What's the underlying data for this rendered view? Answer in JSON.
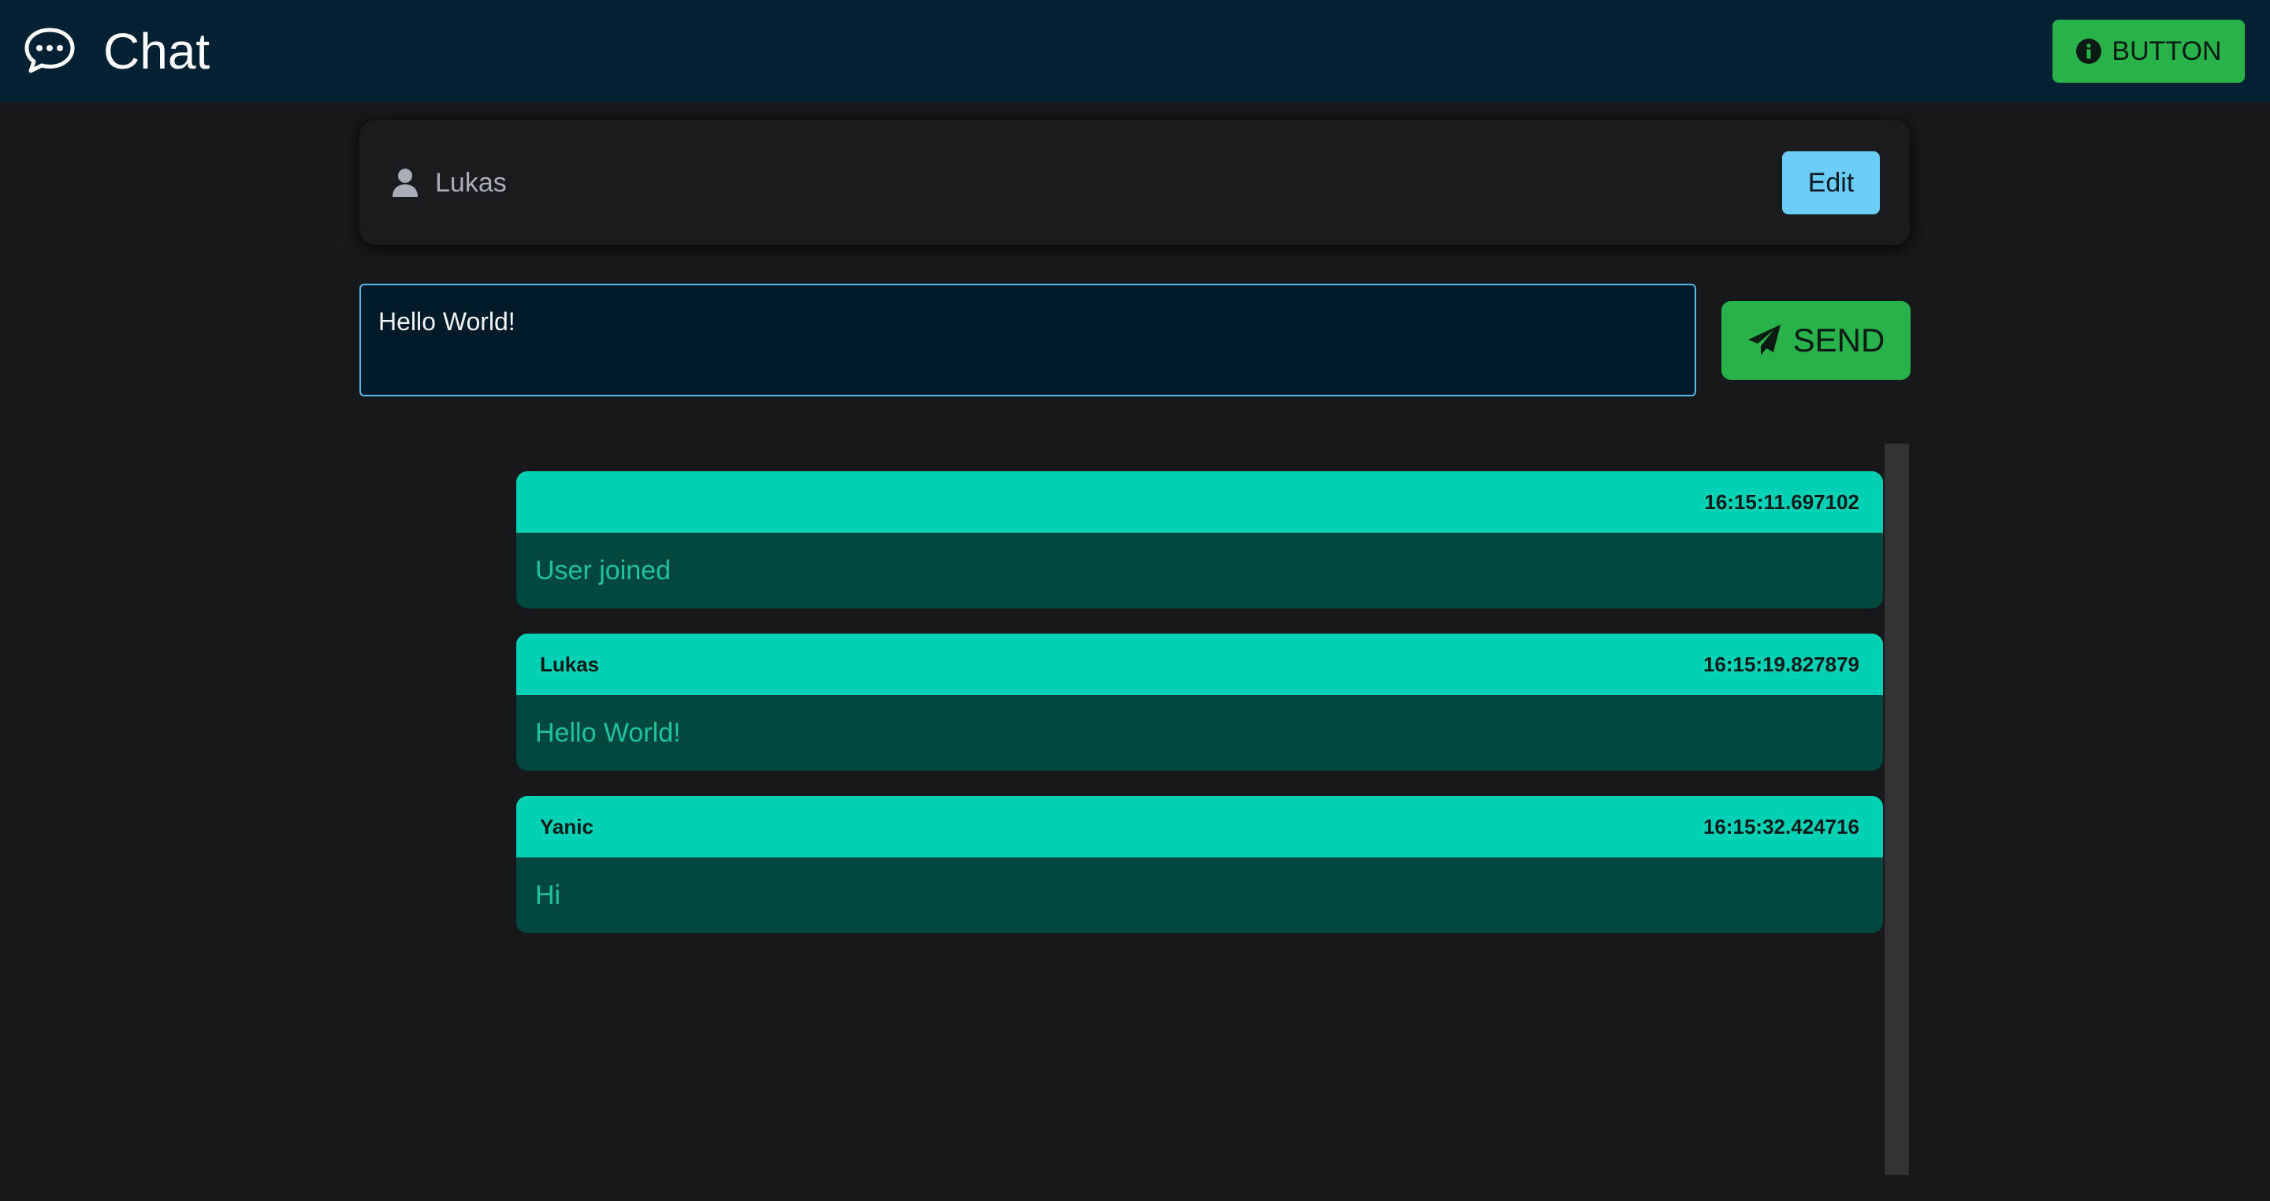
{
  "header": {
    "title": "Chat",
    "logo_icon": "chat-bubble-icon",
    "button_label": "BUTTON",
    "button_icon": "info-icon",
    "background": "#022133",
    "button_color": "#27b24a"
  },
  "user_card": {
    "icon": "user-icon",
    "name": "Lukas",
    "edit_label": "Edit",
    "edit_color": "#6bcdf6"
  },
  "composer": {
    "value": "Hello World!",
    "send_label": "SEND",
    "send_icon": "paper-plane-icon"
  },
  "messages": [
    {
      "sender": "",
      "time": "16:15:11.697102",
      "text": "User joined"
    },
    {
      "sender": "Lukas",
      "time": "16:15:19.827879",
      "text": "Hello World!"
    },
    {
      "sender": "Yanic",
      "time": "16:15:32.424716",
      "text": "Hi"
    }
  ],
  "colors": {
    "page_background": "#17181c",
    "message_header": "#00d0b3",
    "message_body": "#00483d",
    "message_text": "#1fc2a0"
  }
}
